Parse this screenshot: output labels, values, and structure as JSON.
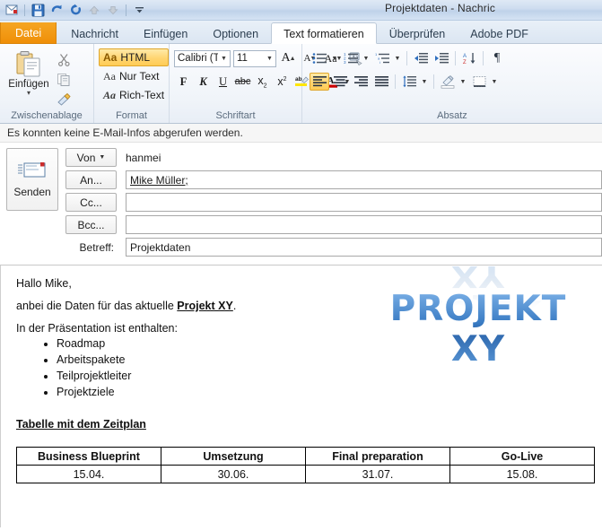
{
  "window": {
    "title": "Projektdaten  -  Nachric",
    "quick_access": [
      {
        "name": "message-icon",
        "label": "Nachricht"
      },
      {
        "name": "save-icon",
        "label": "Speichern"
      },
      {
        "name": "undo-icon",
        "label": "Rückgängig"
      },
      {
        "name": "redo-icon",
        "label": "Wiederholen"
      },
      {
        "name": "previous-item-icon",
        "label": "Vorheriges Element"
      },
      {
        "name": "next-item-icon",
        "label": "Nächstes Element"
      },
      {
        "name": "customize-qat-icon",
        "label": "Symbolleiste anpassen"
      }
    ]
  },
  "tabs": [
    {
      "label": "Datei",
      "kind": "file",
      "active": false
    },
    {
      "label": "Nachricht",
      "kind": "normal",
      "active": false
    },
    {
      "label": "Einfügen",
      "kind": "normal",
      "active": false
    },
    {
      "label": "Optionen",
      "kind": "normal",
      "active": false
    },
    {
      "label": "Text formatieren",
      "kind": "normal",
      "active": true
    },
    {
      "label": "Überprüfen",
      "kind": "normal",
      "active": false
    },
    {
      "label": "Adobe PDF",
      "kind": "normal",
      "active": false
    }
  ],
  "ribbon": {
    "groups": {
      "clipboard": {
        "label": "Zwischenablage",
        "paste_label": "Einfügen",
        "cut_label": "Ausschneiden",
        "copy_label": "Kopieren",
        "format_painter_label": "Format übertragen"
      },
      "format": {
        "label": "Format",
        "items": [
          {
            "label": "HTML",
            "selected": true
          },
          {
            "label": "Nur Text",
            "selected": false
          },
          {
            "label": "Rich-Text",
            "selected": false
          }
        ]
      },
      "font": {
        "label": "Schriftart",
        "font_name": "Calibri (T",
        "font_size": "11",
        "grow_label": "A",
        "shrink_label": "A",
        "change_case_label": "Aa",
        "clear_formatting_label": "Formatierung löschen",
        "bold_label": "F",
        "italic_label": "K",
        "underline_label": "U",
        "strike_label": "abc",
        "subscript_label": "x",
        "superscript_label": "x",
        "highlight_label": "ab",
        "font_color_label": "A"
      },
      "paragraph": {
        "label": "Absatz",
        "bullets_label": "Aufzählungszeichen",
        "numbering_label": "Nummerierung",
        "multilevel_label": "Liste mit mehreren Ebenen",
        "decrease_indent_label": "Einzug verkleinern",
        "increase_indent_label": "Einzug vergrößern",
        "sort_label": "Sortieren",
        "marks_label": "¶",
        "align_left_label": "Linksbündig",
        "align_center_label": "Zentriert",
        "align_right_label": "Rechtsbündig",
        "justify_label": "Blocksatz",
        "line_spacing_label": "Zeilenabstand",
        "shading_label": "Schattierung",
        "borders_label": "Rahmen",
        "align_active": "left"
      }
    }
  },
  "infobar": {
    "message": "Es konnten keine E-Mail-Infos abgerufen werden."
  },
  "compose": {
    "send_label": "Senden",
    "fields": {
      "from_button": "Von",
      "from_value": "hanmei",
      "to_button": "An...",
      "to_value": "Mike Müller;",
      "cc_button": "Cc...",
      "cc_value": "",
      "bcc_button": "Bcc...",
      "bcc_value": "",
      "subject_label": "Betreff:",
      "subject_value": "Projektdaten"
    }
  },
  "body": {
    "greeting": "Hallo Mike,",
    "intro_pre": "anbei die Daten für das aktuelle ",
    "intro_strong": "Projekt XY",
    "intro_post": ".",
    "list_intro": "In der Präsentation ist enthalten:",
    "bullets": [
      "Roadmap",
      "Arbeitspakete",
      "Teilprojektleiter",
      "Projektziele"
    ],
    "table_heading": "Tabelle mit dem Zeitplan",
    "logo_text": "PROJEKT XY",
    "logo_color": "#3a7cc4"
  },
  "chart_data": {
    "type": "table",
    "title": "Tabelle mit dem Zeitplan",
    "columns": [
      "Business Blueprint",
      "Umsetzung",
      "Final preparation",
      "Go-Live"
    ],
    "rows": [
      [
        "15.04.",
        "30.06.",
        "31.07.",
        "15.08."
      ]
    ]
  },
  "colors": {
    "file_tab": "#f0920c",
    "highlight_selected": "#ffd571",
    "accent_blue": "#3a7cc4"
  }
}
